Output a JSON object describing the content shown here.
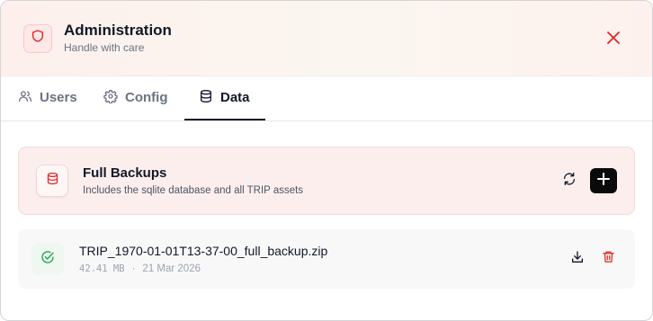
{
  "header": {
    "title": "Administration",
    "subtitle": "Handle with care",
    "icon": "shield-icon",
    "close_icon": "close-icon"
  },
  "tabs": [
    {
      "label": "Users",
      "icon": "users-icon",
      "active": false
    },
    {
      "label": "Config",
      "icon": "gear-icon",
      "active": false
    },
    {
      "label": "Data",
      "icon": "database-icon",
      "active": true
    }
  ],
  "backups_section": {
    "title": "Full Backups",
    "subtitle": "Includes the sqlite database and all TRIP assets",
    "icon": "database-icon",
    "refresh_icon": "refresh-icon",
    "add_icon": "plus-icon"
  },
  "backups": [
    {
      "filename": "TRIP_1970-01-01T13-37-00_full_backup.zip",
      "size": "42.41 MB",
      "separator": "·",
      "date": "21 Mar 2026",
      "status_icon": "check-circle-icon",
      "download_icon": "download-icon",
      "delete_icon": "trash-icon"
    }
  ],
  "colors": {
    "accent_red": "#dc2626",
    "success_green": "#16a34a",
    "active_tab": "#111827",
    "inactive_tab": "#6b7280"
  }
}
